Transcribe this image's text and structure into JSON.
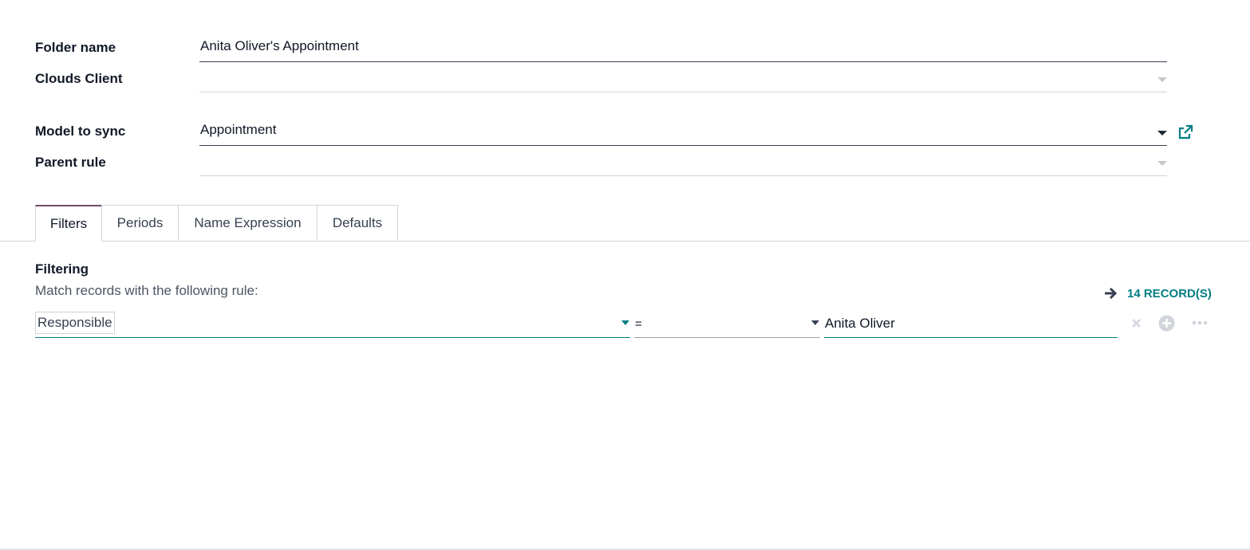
{
  "form": {
    "folder_name_label": "Folder name",
    "folder_name_value": "Anita Oliver's Appointment",
    "clouds_client_label": "Clouds Client",
    "clouds_client_value": "",
    "model_label": "Model to sync",
    "model_value": "Appointment",
    "parent_rule_label": "Parent rule",
    "parent_rule_value": ""
  },
  "tabs": [
    {
      "label": "Filters",
      "active": true
    },
    {
      "label": "Periods",
      "active": false
    },
    {
      "label": "Name Expression",
      "active": false
    },
    {
      "label": "Defaults",
      "active": false
    }
  ],
  "filters": {
    "title": "Filtering",
    "description": "Match records with the following rule:",
    "records_label": "14 RECORD(S)",
    "rule": {
      "path": "Responsible",
      "operator": "=",
      "value": "Anita Oliver"
    }
  },
  "colors": {
    "accent": "#017e84",
    "brand": "#714b67"
  },
  "icons": {
    "external_link": "external-link-icon",
    "arrow": "arrow-right-icon",
    "remove": "close-icon",
    "add": "plus-circle-icon",
    "more": "ellipsis-icon"
  }
}
